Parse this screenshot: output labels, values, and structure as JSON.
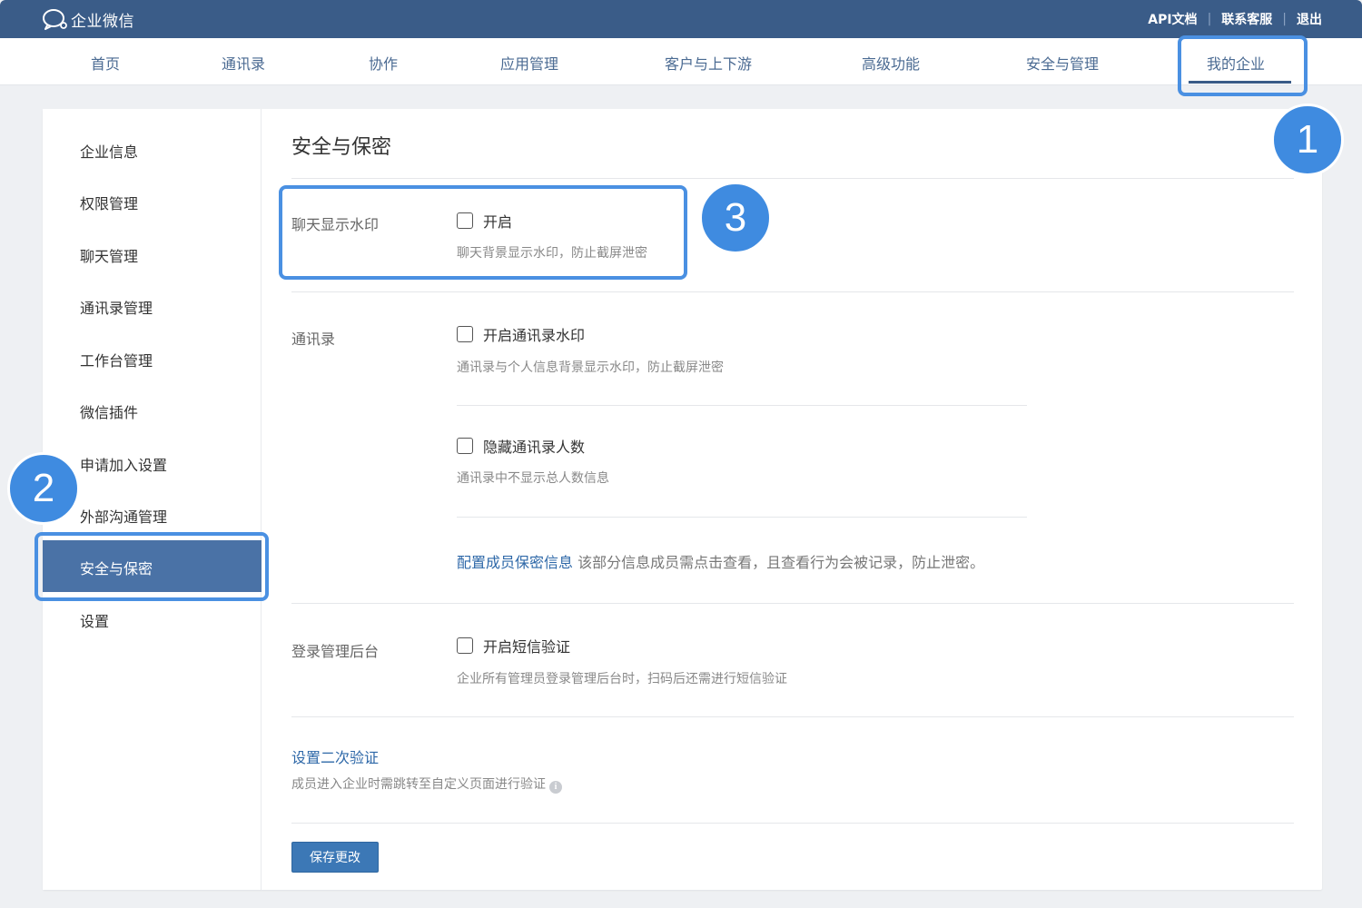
{
  "app": {
    "name": "企业微信"
  },
  "top_links": {
    "api": "API文档",
    "support": "联系客服",
    "logout": "退出"
  },
  "nav": {
    "items": [
      {
        "label": "首页"
      },
      {
        "label": "通讯录"
      },
      {
        "label": "协作"
      },
      {
        "label": "应用管理"
      },
      {
        "label": "客户与上下游"
      },
      {
        "label": "高级功能"
      },
      {
        "label": "安全与管理"
      },
      {
        "label": "我的企业"
      }
    ],
    "active": "我的企业"
  },
  "sidebar": {
    "items": [
      {
        "label": "企业信息"
      },
      {
        "label": "权限管理"
      },
      {
        "label": "聊天管理"
      },
      {
        "label": "通讯录管理"
      },
      {
        "label": "工作台管理"
      },
      {
        "label": "微信插件"
      },
      {
        "label": "申请加入设置"
      },
      {
        "label": "外部沟通管理"
      },
      {
        "label": "安全与保密"
      },
      {
        "label": "设置"
      }
    ],
    "active": "安全与保密"
  },
  "badges": {
    "b1": "1",
    "b2": "2",
    "b3": "3"
  },
  "main": {
    "title": "安全与保密",
    "chat": {
      "label": "聊天显示水印",
      "option": "开启",
      "desc": "聊天背景显示水印，防止截屏泄密"
    },
    "contacts": {
      "label": "通讯录",
      "opt1": "开启通讯录水印",
      "desc1": "通讯录与个人信息背景显示水印，防止截屏泄密",
      "opt2": "隐藏通讯录人数",
      "desc2": "通讯录中不显示总人数信息",
      "config_link": "配置成员保密信息",
      "config_desc": "该部分信息成员需点击查看，且查看行为会被记录，防止泄密。"
    },
    "login": {
      "label": "登录管理后台",
      "option": "开启短信验证",
      "desc": "企业所有管理员登录管理后台时，扫码后还需进行短信验证"
    },
    "second_verify": {
      "link": "设置二次验证",
      "desc": "成员进入企业时需跳转至自定义页面进行验证",
      "info_glyph": "i"
    },
    "save": "保存更改"
  },
  "colors": {
    "topbar": "#3a5c88",
    "nav_text": "#4a6a92",
    "active_sidebar": "#4a72a6",
    "highlight": "#4a90e2",
    "badge": "#3f8be0",
    "link": "#2e68a8",
    "save_button": "#3c78b6"
  }
}
